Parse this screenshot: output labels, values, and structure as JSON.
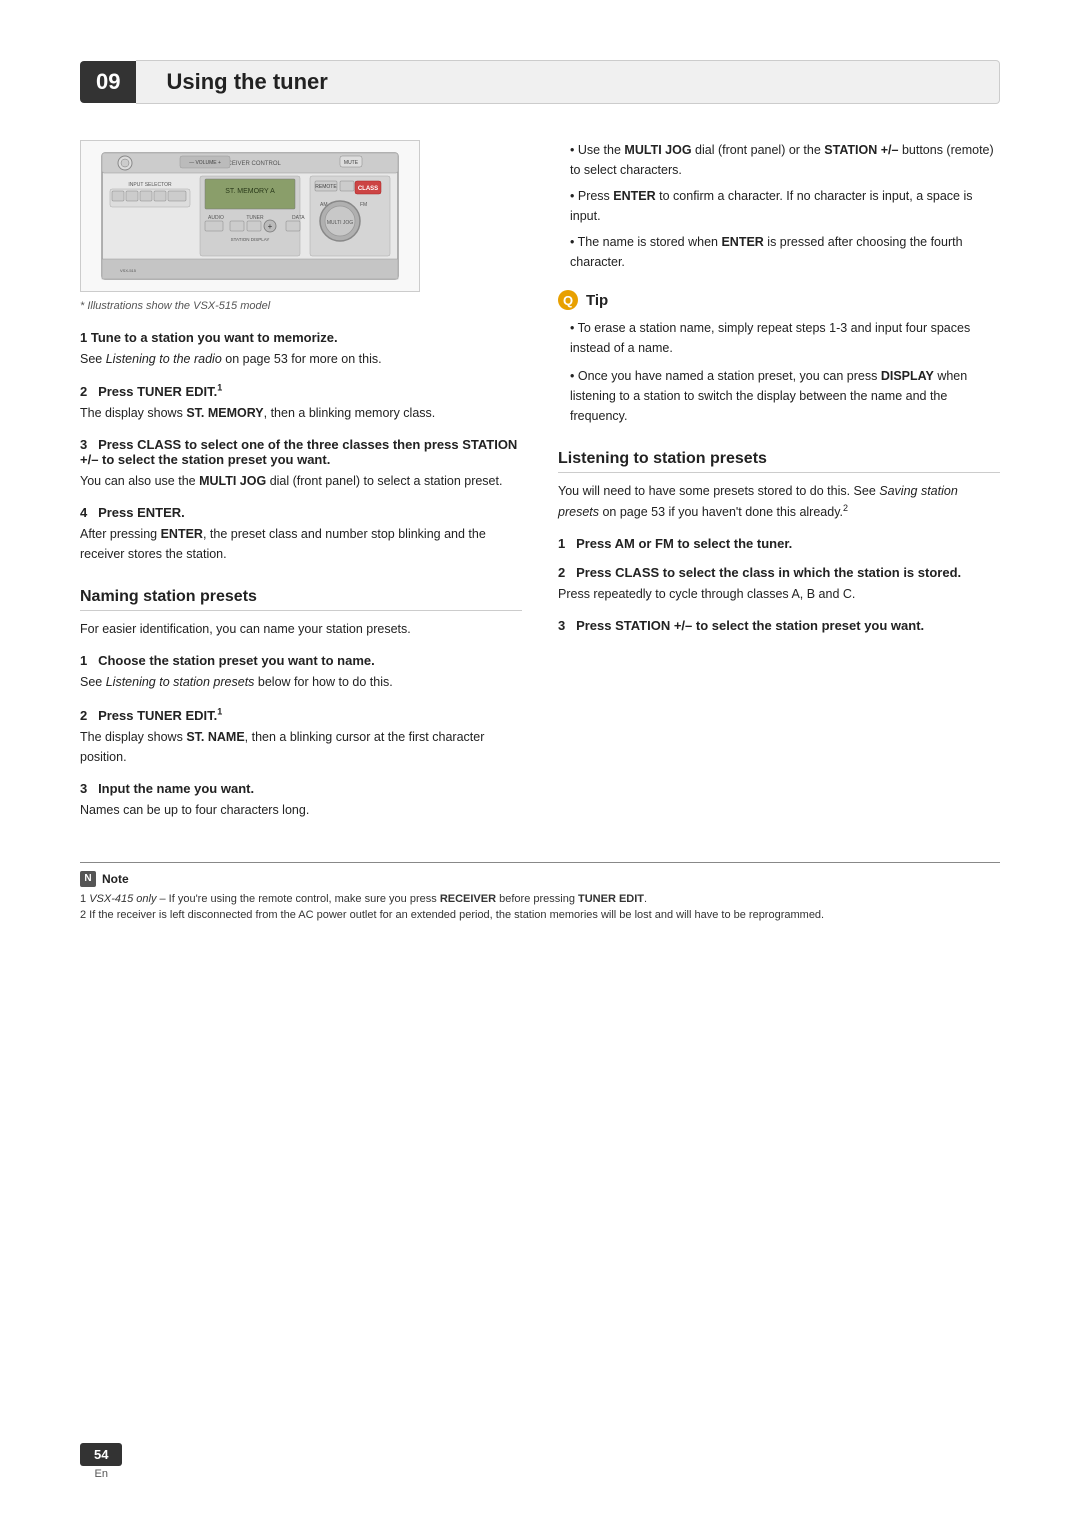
{
  "chapter": {
    "number": "09",
    "title": "Using the tuner"
  },
  "device_image": {
    "caption": "* Illustrations show the VSX-515 model"
  },
  "left_column": {
    "intro_step1_heading": "1   Tune to a station you want to memorize.",
    "intro_step1_text": "See Listening to the radio on page 53 for more on this.",
    "intro_step2_heading": "2   Press TUNER EDIT.",
    "intro_step2_sup": "1",
    "intro_step2_text": "The display shows ST. MEMORY, then a blinking memory class.",
    "intro_step3_heading": "3   Press CLASS to select one of the three classes then press STATION +/– to select the station preset you want.",
    "intro_step3_text": "You can also use the MULTI JOG dial (front panel) to select a station preset.",
    "intro_step4_heading": "4   Press ENTER.",
    "intro_step4_text": "After pressing ENTER, the preset class and number stop blinking and the receiver stores the station.",
    "naming_section": {
      "heading": "Naming station presets",
      "intro": "For easier identification, you can name your station presets.",
      "step1_heading": "1   Choose the station preset you want to name.",
      "step1_text": "See Listening to station presets below for how to do this.",
      "step2_heading": "2   Press TUNER EDIT.",
      "step2_sup": "1",
      "step2_text": "The display shows ST. NAME, then a blinking cursor at the first character position.",
      "step3_heading": "3   Input the name you want.",
      "step3_text": "Names can be up to four characters long."
    }
  },
  "right_column": {
    "bullet1": "Use the MULTI JOG dial (front panel) or the STATION +/– buttons (remote) to select characters.",
    "bullet2": "Press ENTER to confirm a character. If no character is input, a space is input.",
    "bullet3": "The name is stored when ENTER is pressed after choosing the fourth character.",
    "tip": {
      "heading": "Tip",
      "items": [
        "To erase a station name, simply repeat steps 1-3 and input four spaces instead of a name.",
        "Once you have named a station preset, you can press DISPLAY when listening to a station to switch the display between the name and the frequency."
      ]
    },
    "listening_section": {
      "heading": "Listening to station presets",
      "intro": "You will need to have some presets stored to do this. See Saving station presets on page 53 if you haven't done this already.",
      "intro_sup": "2",
      "step1_heading": "1   Press AM or FM to select the tuner.",
      "step2_heading": "2   Press CLASS to select the class in which the station is stored.",
      "step2_text": "Press repeatedly to cycle through classes A, B and C.",
      "step3_heading": "3   Press STATION +/– to select the station preset you want."
    }
  },
  "note": {
    "heading": "Note",
    "items": [
      "1  VSX-415 only – If you're using the remote control, make sure you press RECEIVER before pressing TUNER EDIT.",
      "2  If the receiver is left disconnected from the AC power outlet for an extended period, the station memories will be lost and will have to be reprogrammed."
    ]
  },
  "page": {
    "number": "54",
    "lang": "En"
  }
}
